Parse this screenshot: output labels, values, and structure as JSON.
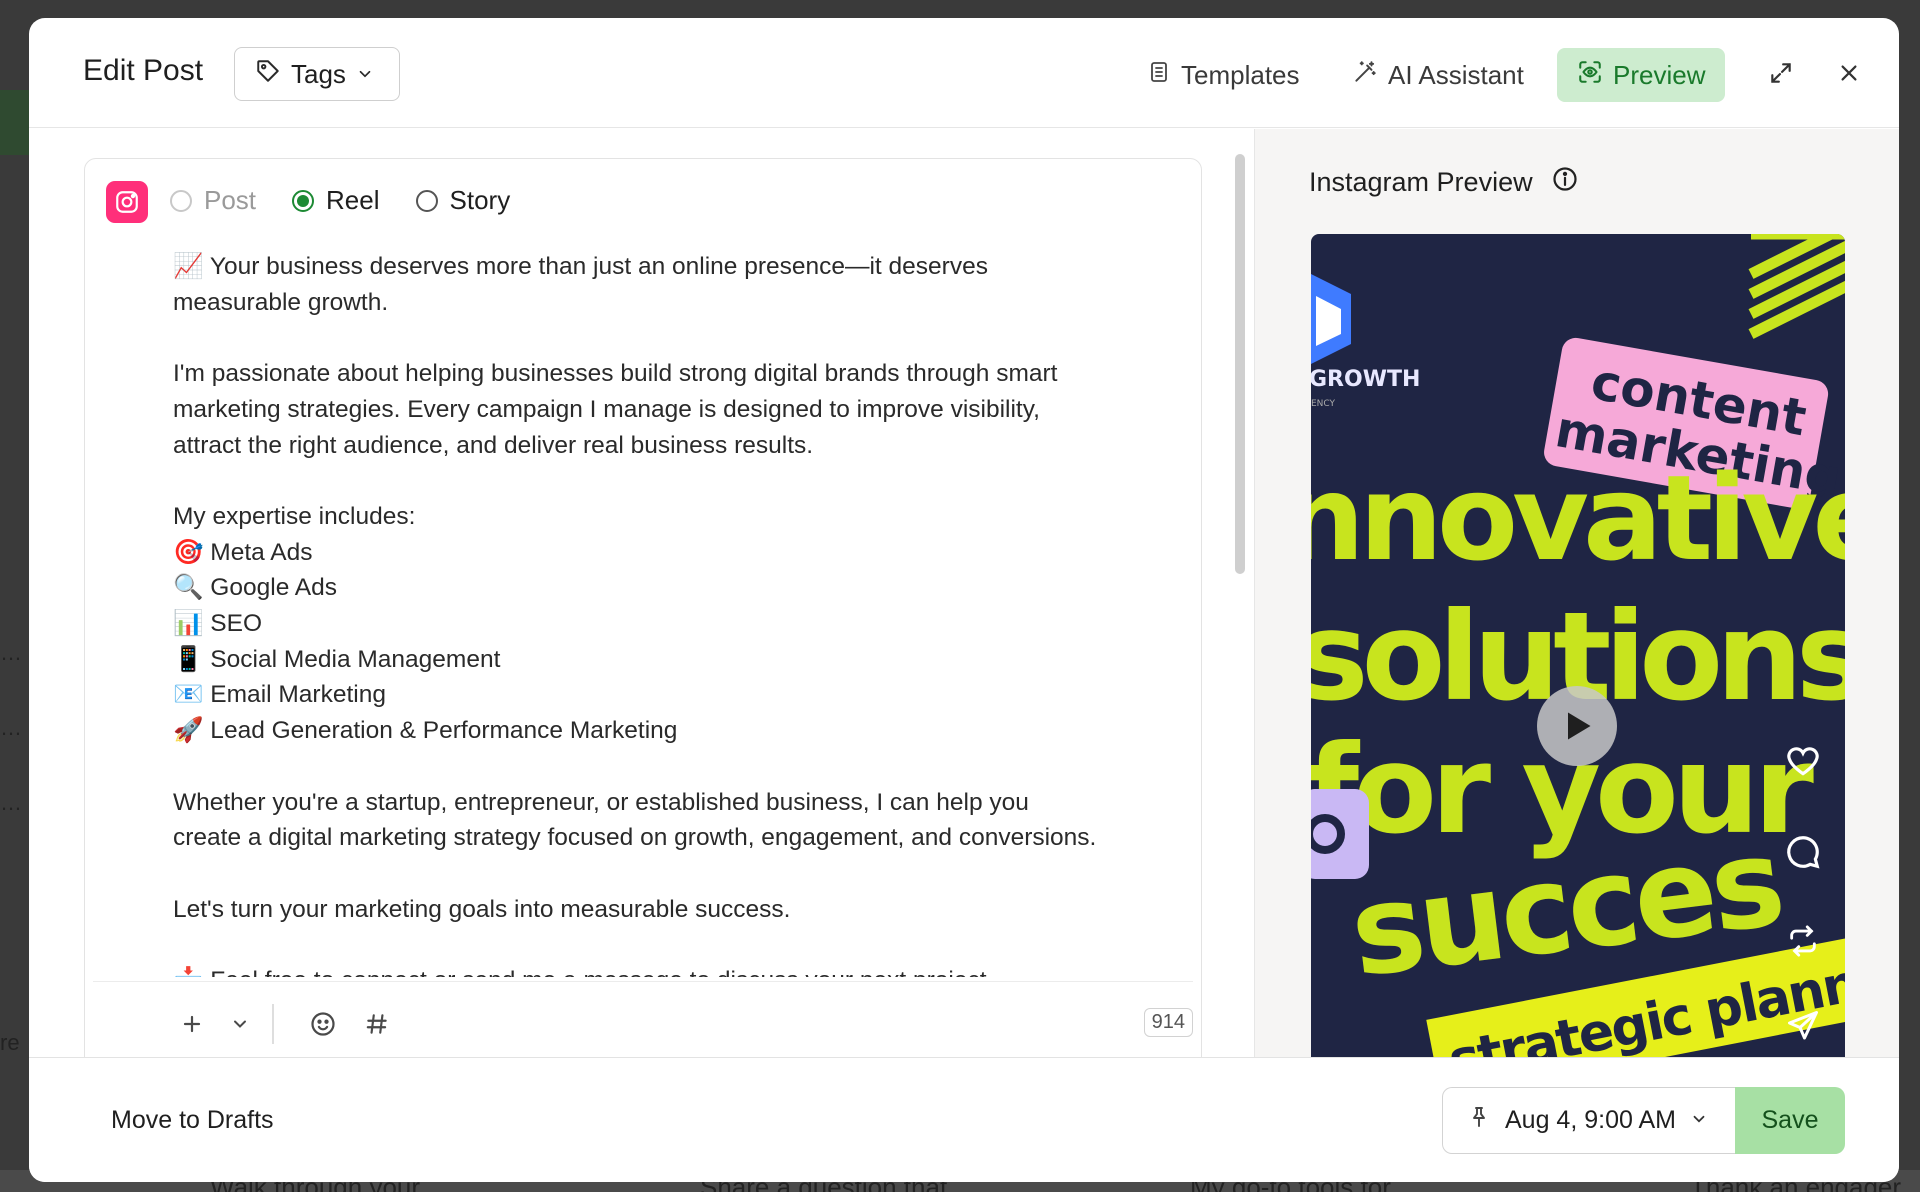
{
  "background": {
    "bottom_texts": [
      "Walk through your",
      "Share a question that",
      "My go-to tools for",
      "Thank an engager"
    ],
    "side_texts": [
      "…",
      "…",
      "…",
      "re"
    ]
  },
  "header": {
    "title": "Edit Post",
    "tags_label": "Tags",
    "templates_label": "Templates",
    "ai_label": "AI Assistant",
    "preview_label": "Preview"
  },
  "editor": {
    "post_types": [
      {
        "label": "Post",
        "state": "disabled"
      },
      {
        "label": "Reel",
        "state": "checked"
      },
      {
        "label": "Story",
        "state": "unchecked"
      }
    ],
    "text": "📈 Your business deserves more than just an online presence—it deserves\nmeasurable growth.\n\nI'm passionate about helping businesses build strong digital brands through smart\nmarketing strategies. Every campaign I manage is designed to improve visibility,\nattract the right audience, and deliver real business results.\n\nMy expertise includes:\n🎯 Meta Ads\n🔍 Google Ads\n📊 SEO\n📱 Social Media Management\n📧 Email Marketing\n🚀 Lead Generation & Performance Marketing\n\nWhether you're a startup, entrepreneur, or established business, I can help you\ncreate a digital marketing strategy focused on growth, engagement, and conversions.\n\nLet's turn your marketing goals into measurable success.\n\n📩 Feel free to connect or send me a message to discuss your next project.",
    "char_count": "914"
  },
  "preview": {
    "label": "Instagram Preview",
    "image_texts": {
      "brand": "GROWTH",
      "brand_sub": "ENCY",
      "sticker": [
        "content",
        "marketing"
      ],
      "headline": [
        "nnovative",
        "solutions",
        "for your",
        "succes"
      ],
      "strip": "strategic planni"
    }
  },
  "footer": {
    "drafts_label": "Move to Drafts",
    "schedule": "Aug 4, 9:00 AM",
    "save_label": "Save"
  },
  "colors": {
    "accent_green": "#1d8a34",
    "preview_bg": "#cdeccf",
    "save_bg": "#a7e0a4",
    "instagram": "#ff2f7a",
    "reel_bg": "#1f2544",
    "reel_text": "#c8e41e",
    "sticker_pink": "#f6a9d8"
  }
}
